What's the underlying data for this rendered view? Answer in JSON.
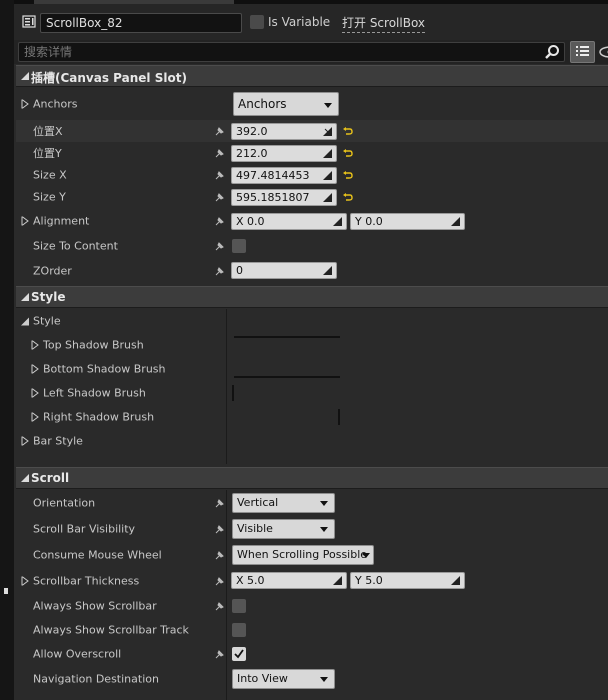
{
  "header": {
    "widget_name": "ScrollBox_82",
    "is_variable_label": "Is Variable",
    "is_variable_checked": false,
    "open_link": "打开 ScrollBox"
  },
  "search": {
    "placeholder": "搜索详情"
  },
  "sections": {
    "slot": "插槽(Canvas Panel Slot)",
    "style": "Style",
    "scroll": "Scroll"
  },
  "slot": {
    "anchors_label": "Anchors",
    "anchors_value": "Anchors",
    "pos_x_label": "位置X",
    "pos_x_value": "392.0",
    "pos_y_label": "位置Y",
    "pos_y_value": "212.0",
    "size_x_label": "Size X",
    "size_x_value": "497.4814453",
    "size_y_label": "Size Y",
    "size_y_value": "595.1851807",
    "alignment_label": "Alignment",
    "alignment_x": "X  0.0",
    "alignment_y": "Y  0.0",
    "size_to_content_label": "Size To Content",
    "size_to_content_checked": false,
    "zorder_label": "ZOrder",
    "zorder_value": "0"
  },
  "style": {
    "style_label": "Style",
    "top_shadow": "Top Shadow Brush",
    "bottom_shadow": "Bottom Shadow Brush",
    "left_shadow": "Left Shadow Brush",
    "right_shadow": "Right Shadow Brush",
    "bar_style": "Bar Style"
  },
  "scroll": {
    "orientation_label": "Orientation",
    "orientation_value": "Vertical",
    "visibility_label": "Scroll Bar Visibility",
    "visibility_value": "Visible",
    "consume_label": "Consume Mouse Wheel",
    "consume_value": "When Scrolling Possible",
    "thickness_label": "Scrollbar Thickness",
    "thickness_x": "X  5.0",
    "thickness_y": "Y  5.0",
    "always_show_label": "Always Show Scrollbar",
    "always_show_checked": false,
    "always_track_label": "Always Show Scrollbar Track",
    "always_track_checked": false,
    "overscroll_label": "Allow Overscroll",
    "overscroll_checked": true,
    "nav_dest_label": "Navigation Destination",
    "nav_dest_value": "Into View"
  },
  "colors": {
    "panel_bg": "#2a2a2a",
    "section_bg": "#3c3c3c",
    "value_box": "#dcdcdc",
    "reset_arrow": "#e8c21a"
  }
}
